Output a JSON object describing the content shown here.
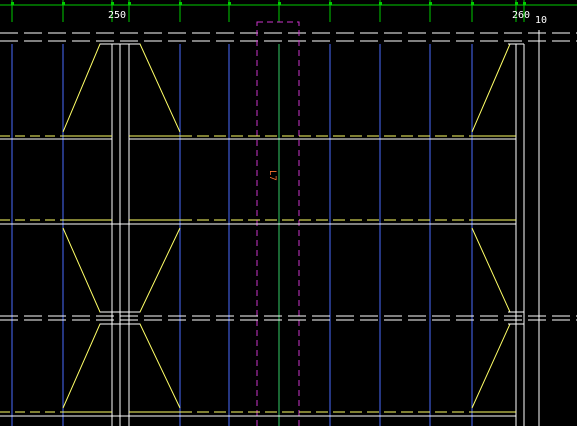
{
  "drawing": {
    "background_color": "#000000",
    "labels": {
      "dimension_left": "250",
      "dimension_right": "260",
      "dimension_far_right": "10",
      "region_label": "L7"
    },
    "colors": {
      "dimension_green": "#00cc00",
      "grid_blue": "#4a6cff",
      "white_line": "#ffffff",
      "yellow_line": "#ffff66",
      "magenta_dashed": "#cc33cc",
      "label_orange": "#ff7733",
      "green_vertical": "#33cc66"
    }
  }
}
